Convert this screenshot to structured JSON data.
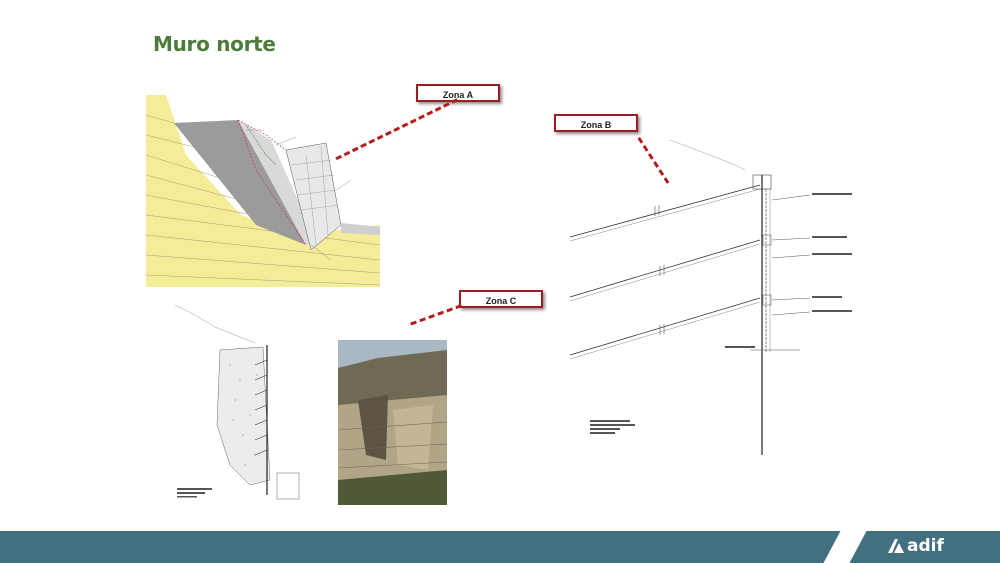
{
  "title": "Muro norte",
  "zones": {
    "a": "Zona A",
    "b": "Zona B",
    "c": "Zona C"
  },
  "brand": {
    "name": "adif",
    "icon": "adif-logo-icon"
  },
  "colors": {
    "title": "#4e7a3b",
    "tag_border": "#9e1b1f",
    "dash": "#b31c1c",
    "footer": "#43707e",
    "soil": "#f5ec9a"
  }
}
